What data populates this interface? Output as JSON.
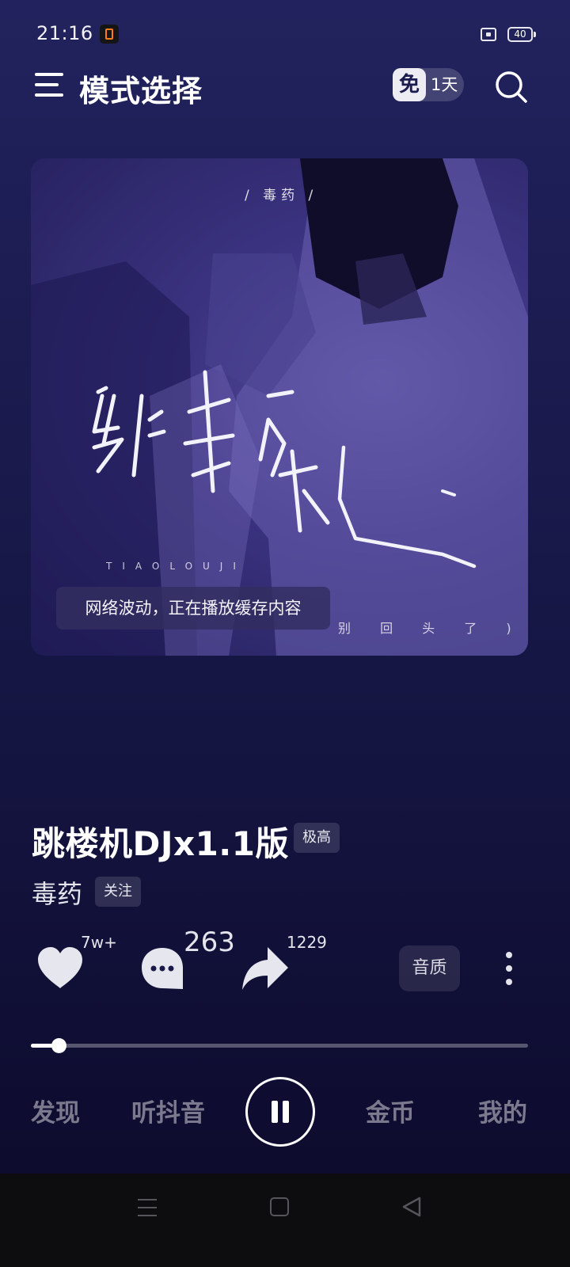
{
  "status_bar": {
    "time": "21:16",
    "battery": "40"
  },
  "header": {
    "title": "模式选择",
    "free_badge": {
      "mark": "免",
      "days": "1天"
    }
  },
  "album": {
    "cover_subtitle": "/ 毒药 /",
    "cover_title": "跳楼机",
    "cover_pinyin": "TIAOLOUJI",
    "cover_lyric_end": "别 回 头 了 )",
    "toast": "网络波动，正在播放缓存内容"
  },
  "song": {
    "title": "跳楼机DJx1.1版",
    "quality_tag": "极高",
    "artist": "毒药",
    "follow_label": "关注"
  },
  "actions": {
    "likes": "7w+",
    "comments": "263",
    "shares": "1229",
    "quality_label": "音质"
  },
  "player": {
    "progress": 0.055,
    "state": "playing"
  },
  "tabs": [
    "发现",
    "听抖音",
    "金币",
    "我的"
  ],
  "icons": [
    "menu-icon",
    "search-icon",
    "heart-icon",
    "comment-icon",
    "share-icon",
    "more-icon",
    "pause-icon"
  ]
}
